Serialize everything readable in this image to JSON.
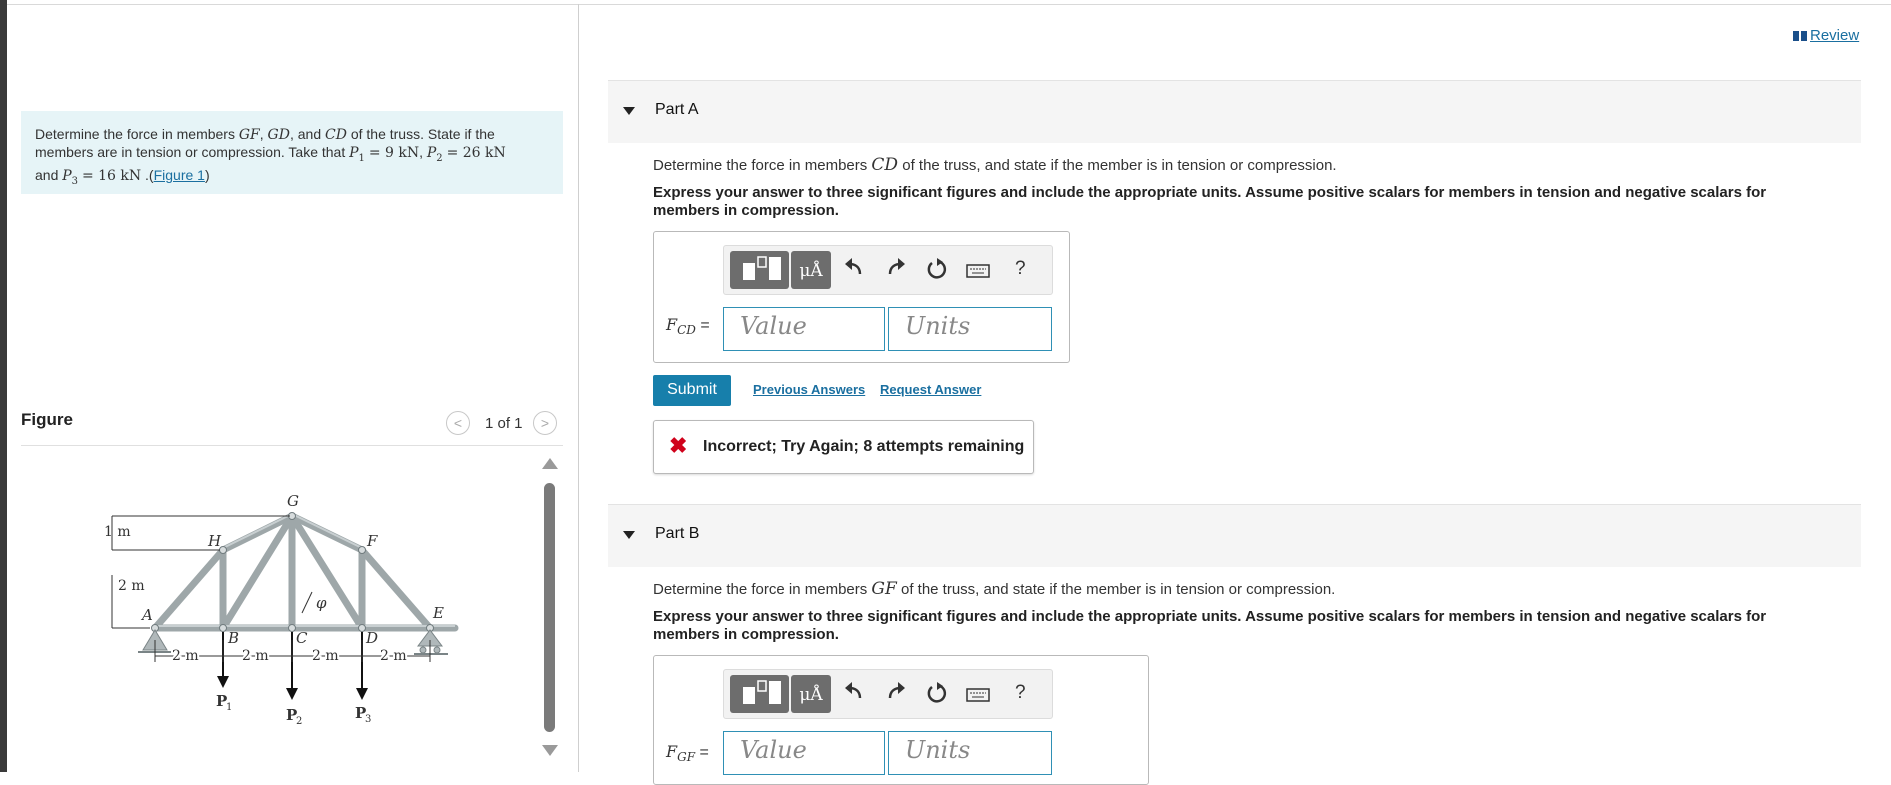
{
  "problem": {
    "text_line1_prefix": "Determine the force in members",
    "m1": "GF",
    "m2": "GD",
    "m3": "CD",
    "text_line1_suffix": "of the truss. State if the",
    "text_line2_a": "members are in tension or compression. Take that",
    "P1": "P",
    "P1_sub": "1",
    "P1_val": "= 9 kN",
    "P2": "P",
    "P2_sub": "2",
    "P2_val": "= 26 kN",
    "text_line3_a": "and",
    "P3": "P",
    "P3_sub": "3",
    "P3_val": "= 16 kN",
    "figure_link": "Figure 1"
  },
  "figure": {
    "title": "Figure",
    "counter": "1 of 1",
    "prev_glyph": "<",
    "next_glyph": ">",
    "labels": {
      "G": "G",
      "H": "H",
      "F": "F",
      "E": "E",
      "A": "A",
      "B": "B",
      "C": "C",
      "D": "D",
      "phi": "φ",
      "h1": "1 m",
      "h2": "2 m",
      "s1": "2 m",
      "s2": "2 m",
      "s3": "2 m",
      "s4": "2 m",
      "P1": "P",
      "P1_sub": "1",
      "P2": "P",
      "P2_sub": "2",
      "P3": "P",
      "P3_sub": "3"
    }
  },
  "review": {
    "label": "Review"
  },
  "partA": {
    "title": "Part A",
    "question_prefix": "Determine the force in members",
    "member": "CD",
    "question_suffix": "of the truss, and state if the member is in tension or compression.",
    "instructions": "Express your answer to three significant figures and include the appropriate units. Assume positive scalars for members in tension and negative scalars for members in compression.",
    "var_main": "F",
    "var_sub": "CD",
    "equals": "=",
    "value_placeholder": "Value",
    "units_placeholder": "Units",
    "submit": "Submit",
    "previous_answers": "Previous Answers",
    "request_answer": "Request Answer",
    "feedback_icon": "✖",
    "feedback": "Incorrect; Try Again; 8 attempts remaining"
  },
  "partB": {
    "title": "Part B",
    "question_prefix": "Determine the force in members",
    "member": "GF",
    "question_suffix": "of the truss, and state if the member is in tension or compression.",
    "instructions": "Express your answer to three significant figures and include the appropriate units. Assume positive scalars for members in tension and negative scalars for members in compression.",
    "var_main": "F",
    "var_sub": "GF",
    "equals": "=",
    "value_placeholder": "Value",
    "units_placeholder": "Units"
  },
  "toolbar": {
    "mu_label": "μÅ",
    "help": "?",
    "icons": [
      "templates-icon",
      "units-icon",
      "undo-icon",
      "redo-icon",
      "reset-icon",
      "keyboard-icon",
      "help-icon"
    ]
  },
  "colors": {
    "accent": "#177fab",
    "problem_bg": "#e6f4f7",
    "error": "#d0021b",
    "truss": "#9ea7a9"
  }
}
